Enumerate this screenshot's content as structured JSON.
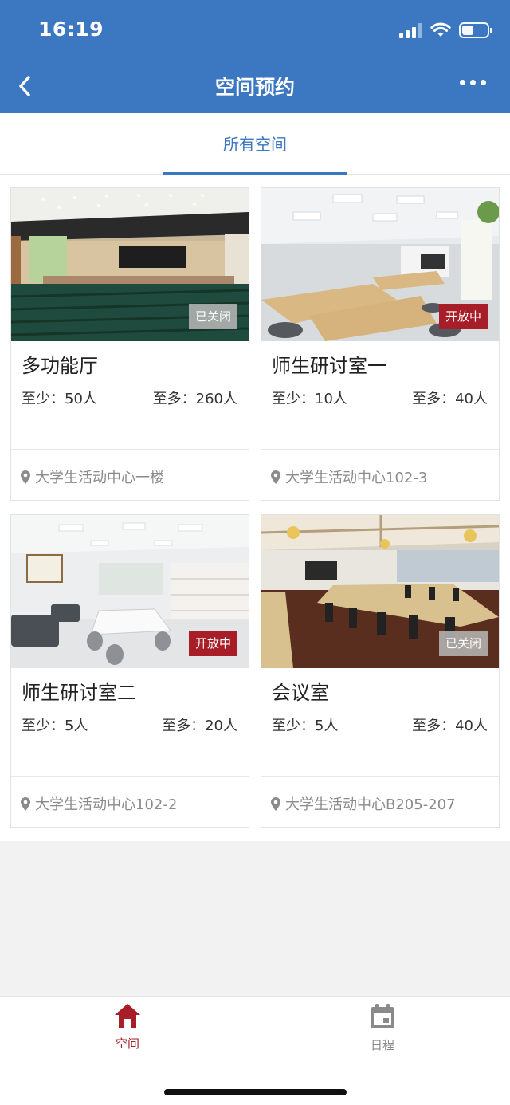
{
  "status_bar": {
    "time": "16:19"
  },
  "header": {
    "title": "空间预约"
  },
  "tabs": [
    {
      "label": "所有空间",
      "active": true
    }
  ],
  "spaces": [
    {
      "name": "多功能厅",
      "min": "至少：50人",
      "max": "至多：260人",
      "status": "已关闭",
      "location": "大学生活动中心一楼"
    },
    {
      "name": "师生研讨室一",
      "min": "至少：10人",
      "max": "至多：40人",
      "status": "开放中",
      "location": "大学生活动中心102-3"
    },
    {
      "name": "师生研讨室二",
      "min": "至少：5人",
      "max": "至多：20人",
      "status": "开放中",
      "location": "大学生活动中心102-2"
    },
    {
      "name": "会议室",
      "min": "至少：5人",
      "max": "至多：40人",
      "status": "已关闭",
      "location": "大学生活动中心B205-207"
    }
  ],
  "bottom_nav": [
    {
      "label": "空间",
      "icon": "home-icon",
      "active": true
    },
    {
      "label": "日程",
      "icon": "calendar-icon",
      "active": false
    }
  ],
  "colors": {
    "primary": "#3c77c2",
    "open_badge": "#a71d28",
    "closed_badge": "#b9b9b9",
    "nav_active": "#a71d28",
    "nav_inactive": "#8a8a8a"
  }
}
